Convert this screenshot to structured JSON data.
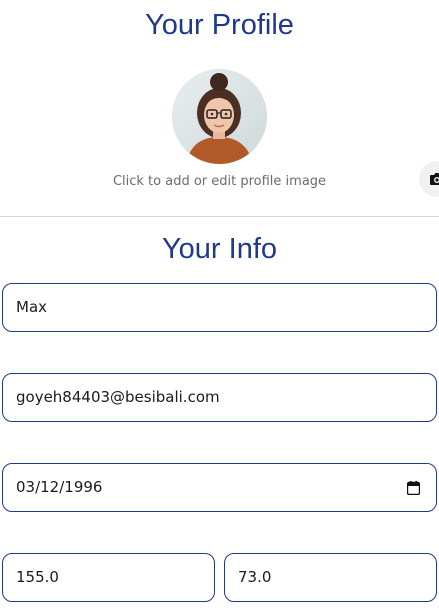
{
  "profile": {
    "title": "Your Profile",
    "avatar_hint": "Click to add or edit profile image",
    "avatar_icon": "user-photo",
    "camera_icon": "camera-icon"
  },
  "info": {
    "title": "Your Info",
    "fields": {
      "name": {
        "value": "Max"
      },
      "email": {
        "value": "goyeh84403@besibali.com"
      },
      "birthdate": {
        "value": "03/12/1996",
        "icon": "calendar-icon"
      },
      "height": {
        "value": "155.0"
      },
      "weight": {
        "value": "73.0"
      }
    }
  },
  "colors": {
    "accent": "#1f3a8a",
    "hint_text": "#6b6b6b",
    "divider": "#d6d6d6"
  }
}
